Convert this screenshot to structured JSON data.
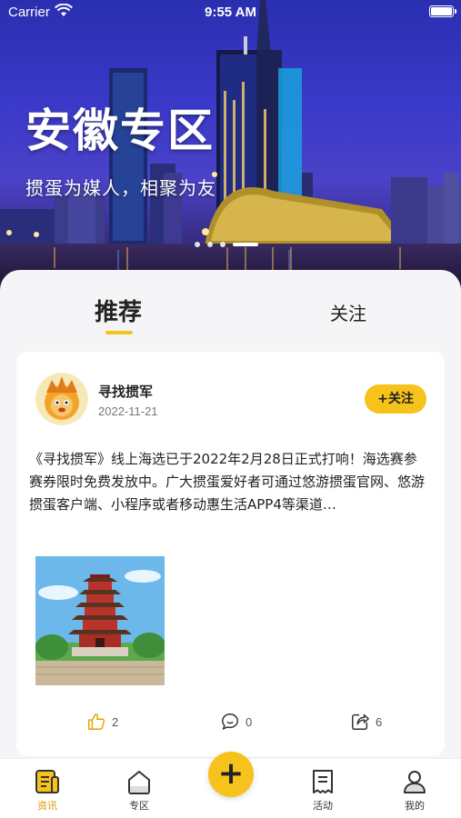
{
  "status_bar": {
    "carrier": "Carrier",
    "time": "9:55 AM"
  },
  "banner": {
    "title": "安徽专区",
    "subtitle": "掼蛋为媒人，相聚为友"
  },
  "tabs": [
    {
      "label": "推荐",
      "active": true
    },
    {
      "label": "关注",
      "active": false
    }
  ],
  "post": {
    "author": "寻找掼军",
    "date": "2022-11-21",
    "follow_label": "+关注",
    "text": "《寻找掼军》线上海选已于2022年2月28日正式打响！海选赛参赛券限时免费发放中。广大掼蛋爱好者可通过悠游掼蛋官网、悠游掼蛋客户端、小程序或者移动惠生活APP4等渠道…",
    "likes": "2",
    "comments": "0",
    "shares": "6"
  },
  "tabbar": {
    "items": [
      {
        "label": "资讯",
        "icon": "news-icon",
        "active": true
      },
      {
        "label": "专区",
        "icon": "zone-icon",
        "active": false
      },
      {
        "label": "活动",
        "icon": "activity-icon",
        "active": false
      },
      {
        "label": "我的",
        "icon": "profile-icon",
        "active": false
      }
    ],
    "center_button": "+"
  },
  "colors": {
    "accent": "#f6c21c",
    "active_tab_text": "#d79b00"
  }
}
